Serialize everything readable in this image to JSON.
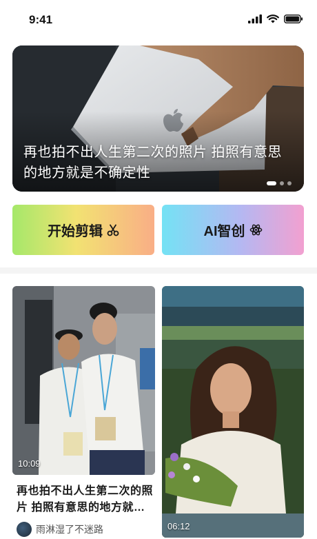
{
  "status_bar": {
    "time": "9:41"
  },
  "banner": {
    "title": "再也拍不出人生第二次的照片 拍照有意思的地方就是不确定性",
    "dots": [
      true,
      false,
      false
    ]
  },
  "actions": {
    "edit_label": "开始剪辑",
    "ai_label": "AI智创"
  },
  "feed": {
    "cards": [
      {
        "duration": "10:09",
        "title": "再也拍不出人生第二次的照片 拍照有意思的地方就是不确定性",
        "author": "雨淋湿了不迷路"
      },
      {
        "duration": "06:12"
      }
    ]
  }
}
